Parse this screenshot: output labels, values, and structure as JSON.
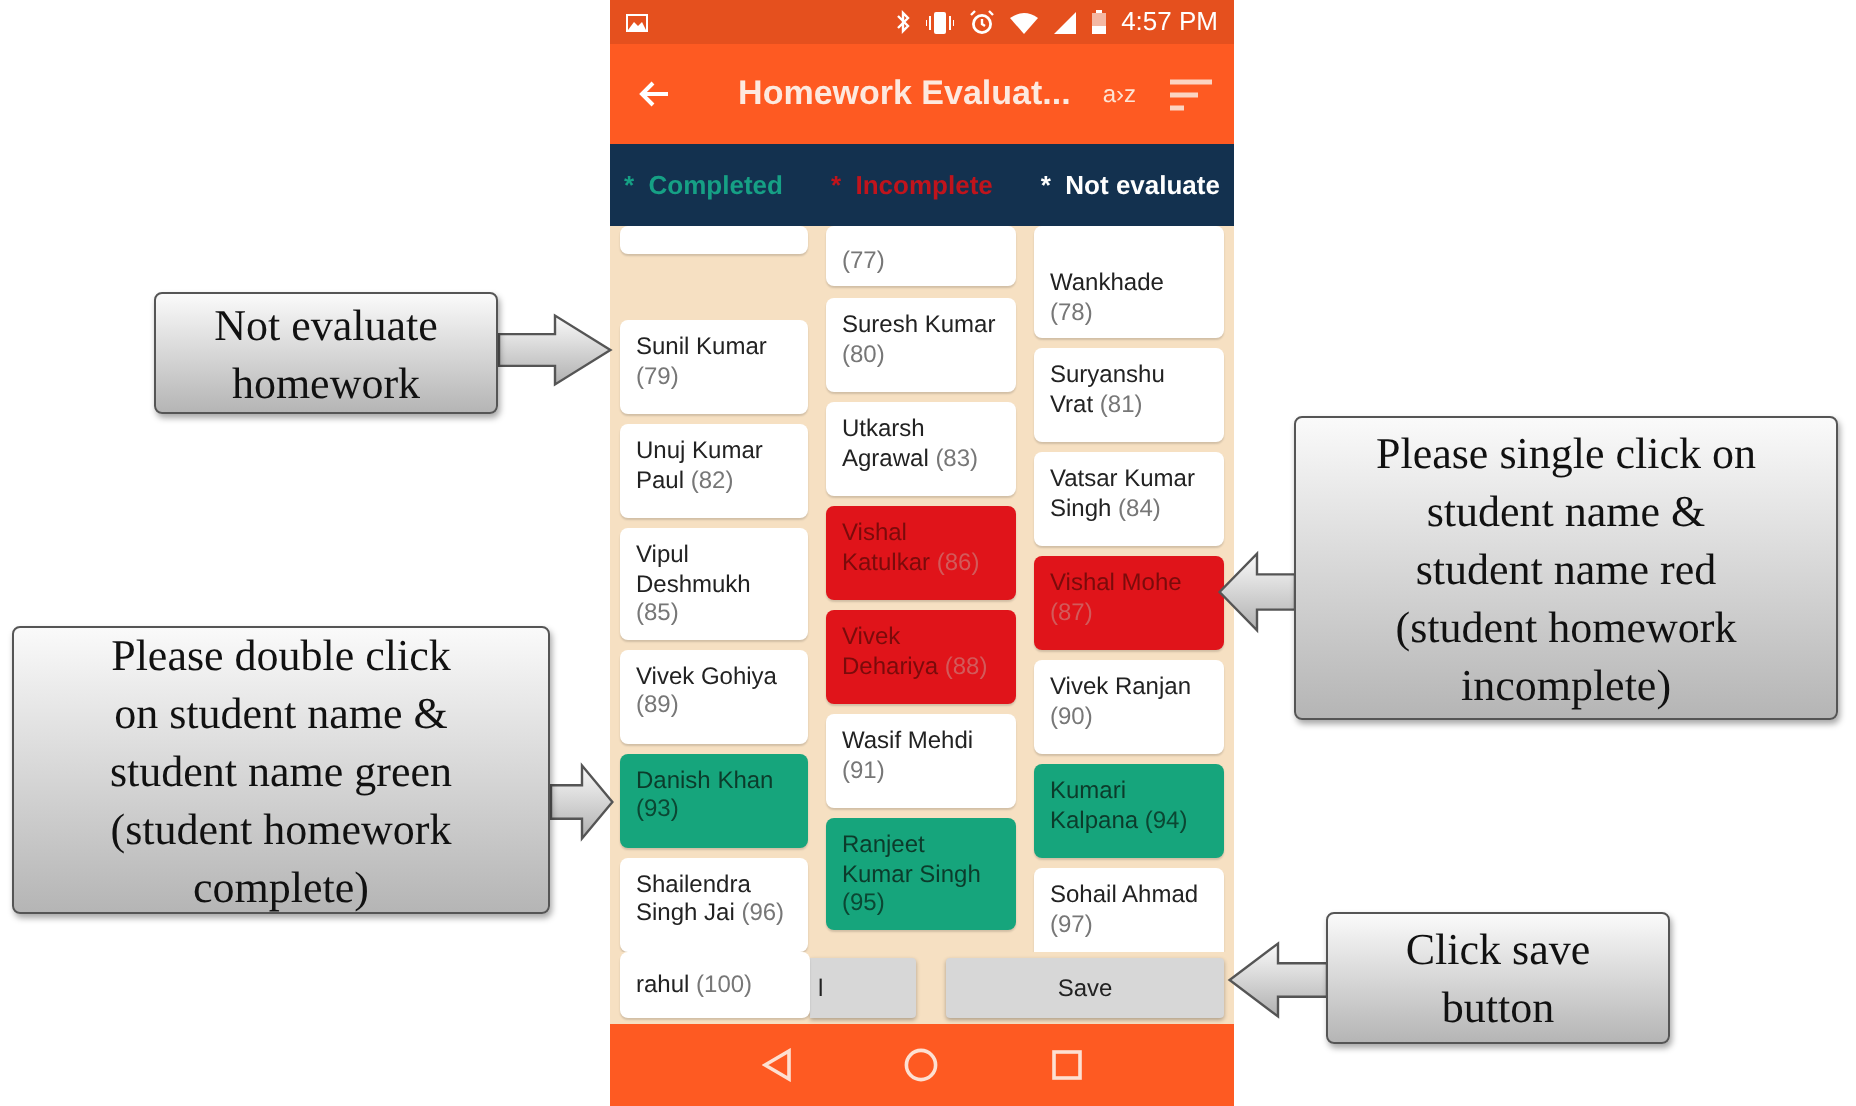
{
  "status_bar": {
    "time": "4:57 PM"
  },
  "app_bar": {
    "title": "Homework Evaluat...",
    "sort_label": "a›z"
  },
  "legend": [
    {
      "marker": "*",
      "label": "Completed",
      "color": "#16a085"
    },
    {
      "marker": "*",
      "label": "Incomplete",
      "color": "#c0141c"
    },
    {
      "marker": "*",
      "label": "Not evaluate",
      "color": "#ffffff"
    }
  ],
  "student_columns": [
    [
      {
        "kind": "not_evaluated"
      },
      {
        "name": "Sunil Kumar",
        "roll": "(79)",
        "kind": "not_evaluated"
      },
      {
        "name": "Unuj Kumar Paul",
        "roll": "(82)",
        "kind": "not_evaluated"
      },
      {
        "name": "Vipul Deshmukh",
        "roll": "(85)",
        "kind": "not_evaluated"
      },
      {
        "name": "Vivek Gohiya",
        "roll": "(89)",
        "kind": "not_evaluated"
      },
      {
        "name": "Danish Khan",
        "roll": "(93)",
        "kind": "complete"
      },
      {
        "name": "Shailendra Singh Jai",
        "roll": "(96)",
        "kind": "not_evaluated"
      }
    ],
    [
      {
        "roll": "(77)",
        "kind": "not_evaluated"
      },
      {
        "name": "Suresh Kumar",
        "roll": "(80)",
        "kind": "not_evaluated"
      },
      {
        "name": "Utkarsh Agrawal",
        "roll": "(83)",
        "kind": "not_evaluated"
      },
      {
        "name": "Vishal Katulkar",
        "roll": "(86)",
        "kind": "incomplete"
      },
      {
        "name": "Vivek Dehariya",
        "roll": "(88)",
        "kind": "incomplete"
      },
      {
        "name": "Wasif Mehdi",
        "roll": "(91)",
        "kind": "not_evaluated"
      },
      {
        "name": "Ranjeet Kumar Singh",
        "roll": "(95)",
        "kind": "complete"
      }
    ],
    [
      {
        "name": "Wankhade",
        "roll": "(78)",
        "kind": "not_evaluated"
      },
      {
        "name": "Suryanshu Vrat",
        "roll": "(81)",
        "kind": "not_evaluated"
      },
      {
        "name": "Vatsar Kumar Singh",
        "roll": "(84)",
        "kind": "not_evaluated"
      },
      {
        "name": "Vishal Mohe",
        "roll": "(87)",
        "kind": "incomplete"
      },
      {
        "name": "Vivek Ranjan",
        "roll": "(90)",
        "kind": "not_evaluated"
      },
      {
        "name": "Kumari Kalpana",
        "roll": "(94)",
        "kind": "complete"
      },
      {
        "name": "Sohail Ahmad",
        "roll": "(97)",
        "kind": "not_evaluated"
      }
    ]
  ],
  "overlay_card": {
    "name": "rahul",
    "roll": "(100)",
    "kind": "not_evaluated"
  },
  "buttons": [
    {
      "label": "l"
    },
    {
      "label": "Save"
    }
  ],
  "callouts": [
    {
      "text": "Not evaluate\nhomework"
    },
    {
      "text": "Please double click\non student name &\nstudent name green\n(student homework\ncomplete)"
    },
    {
      "text": "Please single click on\nstudent name &\nstudent name red\n(student homework\nincomplete)"
    },
    {
      "text": "Click save\nbutton"
    }
  ]
}
